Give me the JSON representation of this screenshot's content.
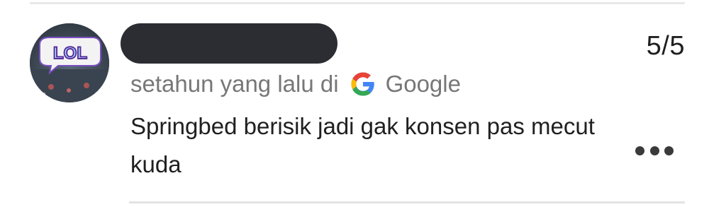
{
  "review": {
    "avatar_text": "LOL",
    "rating": "5/5",
    "time_ago": "setahun yang lalu di",
    "source": "Google",
    "text": "Springbed berisik jadi gak konsen pas mecut kuda"
  },
  "icons": {
    "source_icon": "google-g-icon",
    "menu_icon": "more-options-icon"
  },
  "colors": {
    "redaction": "#2b2d33",
    "meta_text": "#777777"
  }
}
